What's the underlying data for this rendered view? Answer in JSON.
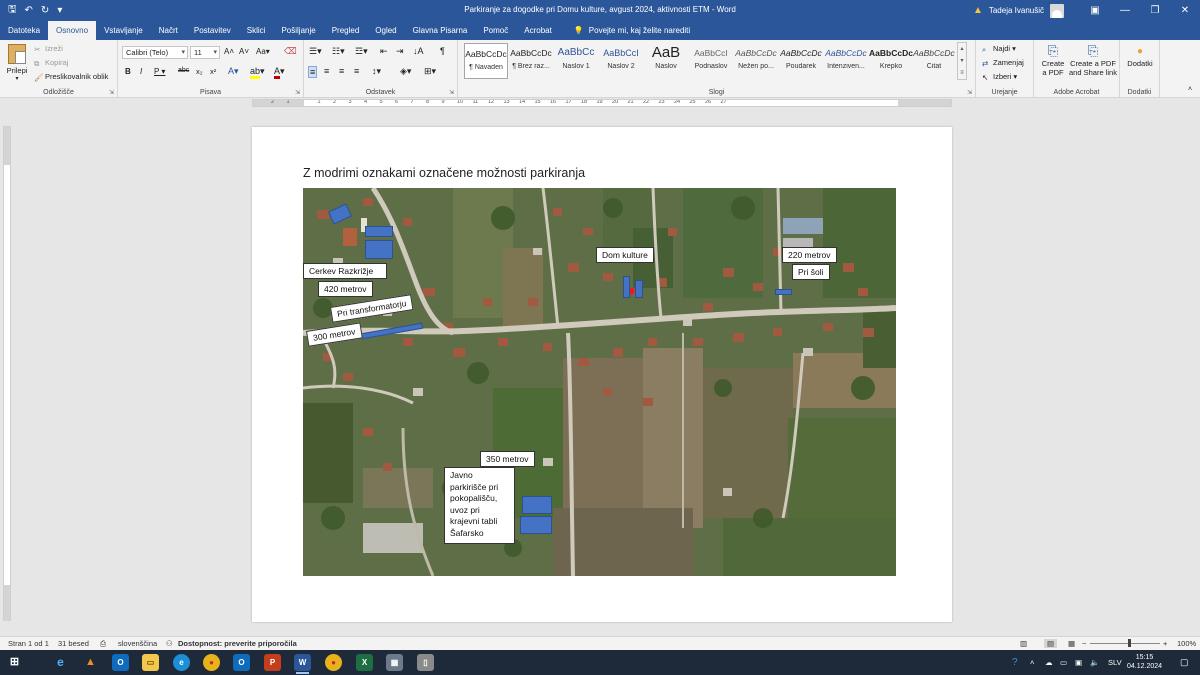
{
  "window": {
    "title": "Parkiranje za dogodke pri Domu kulture, avgust 2024, aktivnosti ETM  -  Word",
    "user": "Tadeja Ivanušič"
  },
  "tabs": [
    "Datoteka",
    "Osnovno",
    "Vstavljanje",
    "Načrt",
    "Postavitev",
    "Sklici",
    "Pošiljanje",
    "Pregled",
    "Ogled",
    "Glavna Pisarna",
    "Pomoč",
    "Acrobat"
  ],
  "active_tab": "Osnovno",
  "tell_me": "Povejte mi, kaj želite narediti",
  "ribbon": {
    "clipboard": {
      "paste": "Prilepi",
      "cut": "Izreži",
      "copy": "Kopiraj",
      "format_painter": "Preslikovalnik oblik",
      "group": "Odložišče"
    },
    "font": {
      "name": "Calibri (Telo)",
      "size": "11",
      "group": "Pisava"
    },
    "paragraph": {
      "group": "Odstavek"
    },
    "styles": {
      "items": [
        {
          "sample": "AaBbCcDc",
          "name": "¶ Navaden"
        },
        {
          "sample": "AaBbCcDc",
          "name": "¶ Brez raz..."
        },
        {
          "sample": "AaBbCc",
          "name": "Naslov 1"
        },
        {
          "sample": "AaBbCcI",
          "name": "Naslov 2"
        },
        {
          "sample": "AaB",
          "name": "Naslov"
        },
        {
          "sample": "AaBbCcI",
          "name": "Podnaslov"
        },
        {
          "sample": "AaBbCcDc",
          "name": "Nežen po..."
        },
        {
          "sample": "AaBbCcDc",
          "name": "Poudarek"
        },
        {
          "sample": "AaBbCcDc",
          "name": "Intenziven..."
        },
        {
          "sample": "AaBbCcDc",
          "name": "Krepko"
        },
        {
          "sample": "AaBbCcDc",
          "name": "Citat"
        }
      ],
      "group": "Slogi"
    },
    "editing": {
      "find": "Najdi",
      "replace": "Zamenjaj",
      "select": "Izberi",
      "group": "Urejanje"
    },
    "acrobat": {
      "create_pdf_1": "Create",
      "create_pdf_2": "a PDF",
      "share_1": "Create a PDF",
      "share_2": "and Share link",
      "group": "Adobe Acrobat"
    },
    "addins": {
      "label": "Dodatki",
      "group": "Dodatki"
    }
  },
  "document": {
    "heading": "Z modrimi oznakami označene možnosti parkiranja",
    "labels": {
      "cerkev": "Cerkev Razkrižje",
      "m420": "420 metrov",
      "transformator": "Pri transformatorju",
      "m300": "300 metrov",
      "dom": "Dom kulture",
      "m220": "220 metrov",
      "soli": "Pri šoli",
      "m350": "350 metrov",
      "javno": "Javno parkirišče pri pokopališču, uvoz pri krajevni tabli Šafarsko"
    }
  },
  "status": {
    "page": "Stran 1 od 1",
    "words": "31 besed",
    "language": "slovenščina",
    "accessibility": "Dostopnost: preverite priporočila",
    "zoom": "100%"
  },
  "taskbar": {
    "lang": "SLV",
    "time": "15:15",
    "date": "04.12.2024"
  },
  "colors": {
    "word_blue": "#2b579a",
    "parking_blue": "#4472c4"
  }
}
